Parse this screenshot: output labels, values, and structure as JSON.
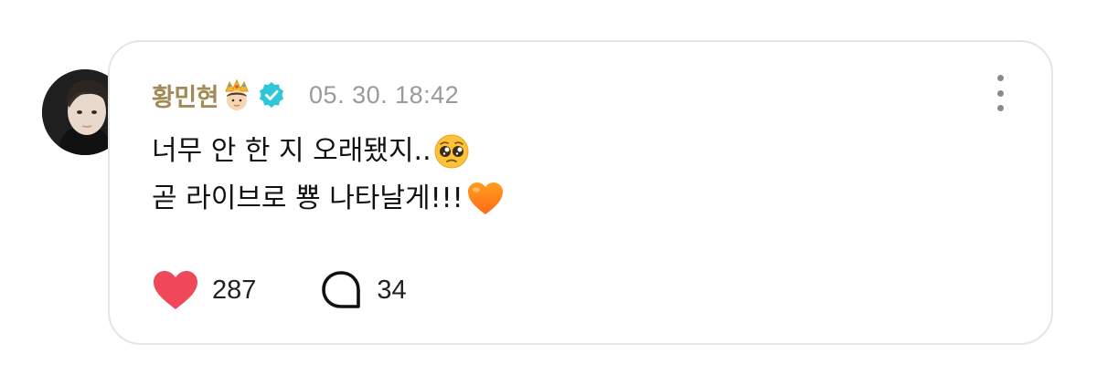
{
  "post": {
    "author": "황민현",
    "author_badge_icon": "crown-face-emoji",
    "verified_icon": "verified-check-icon",
    "timestamp": "05. 30. 18:42",
    "lines": [
      "너무 안 한 지 오래됐지..",
      "곧 라이브로 뿅 나타날게!!!"
    ],
    "line_emojis": [
      "pleading-face-emoji",
      "orange-heart-emoji"
    ],
    "likes": "287",
    "comments": "34",
    "like_icon": "heart-icon",
    "comment_icon": "speech-bubble-icon",
    "more_icon": "more-vertical-icon"
  },
  "colors": {
    "author": "#a18a55",
    "timestamp": "#9a9a9a",
    "like": "#f0485b",
    "verified": "#2ec6d8",
    "card_border": "#e5e5e5"
  }
}
